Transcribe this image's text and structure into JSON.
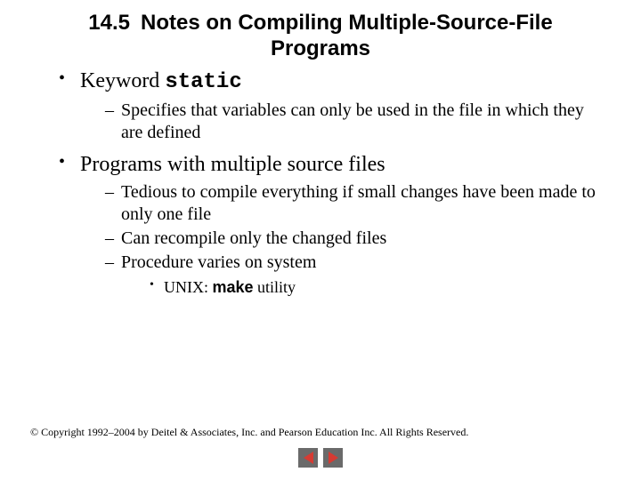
{
  "title": {
    "number": "14.5",
    "text": "Notes on Compiling Multiple-Source-File Programs"
  },
  "bullets": [
    {
      "text_pre": "Keyword ",
      "code": "static",
      "sub": [
        {
          "text": "Specifies that variables can only be used in the file in which they are defined"
        }
      ]
    },
    {
      "text_pre": "Programs with multiple source files",
      "code": "",
      "sub": [
        {
          "text": "Tedious to compile everything if small changes have been made to only one file"
        },
        {
          "text": "Can recompile only the changed files"
        },
        {
          "text": "Procedure varies on system",
          "sub3": [
            {
              "pre": "UNIX: ",
              "code": "make",
              "post": " utility"
            }
          ]
        }
      ]
    }
  ],
  "copyright": "© Copyright 1992–2004 by Deitel & Associates, Inc. and Pearson Education Inc. All Rights Reserved.",
  "nav": {
    "prev": "previous",
    "next": "next"
  }
}
